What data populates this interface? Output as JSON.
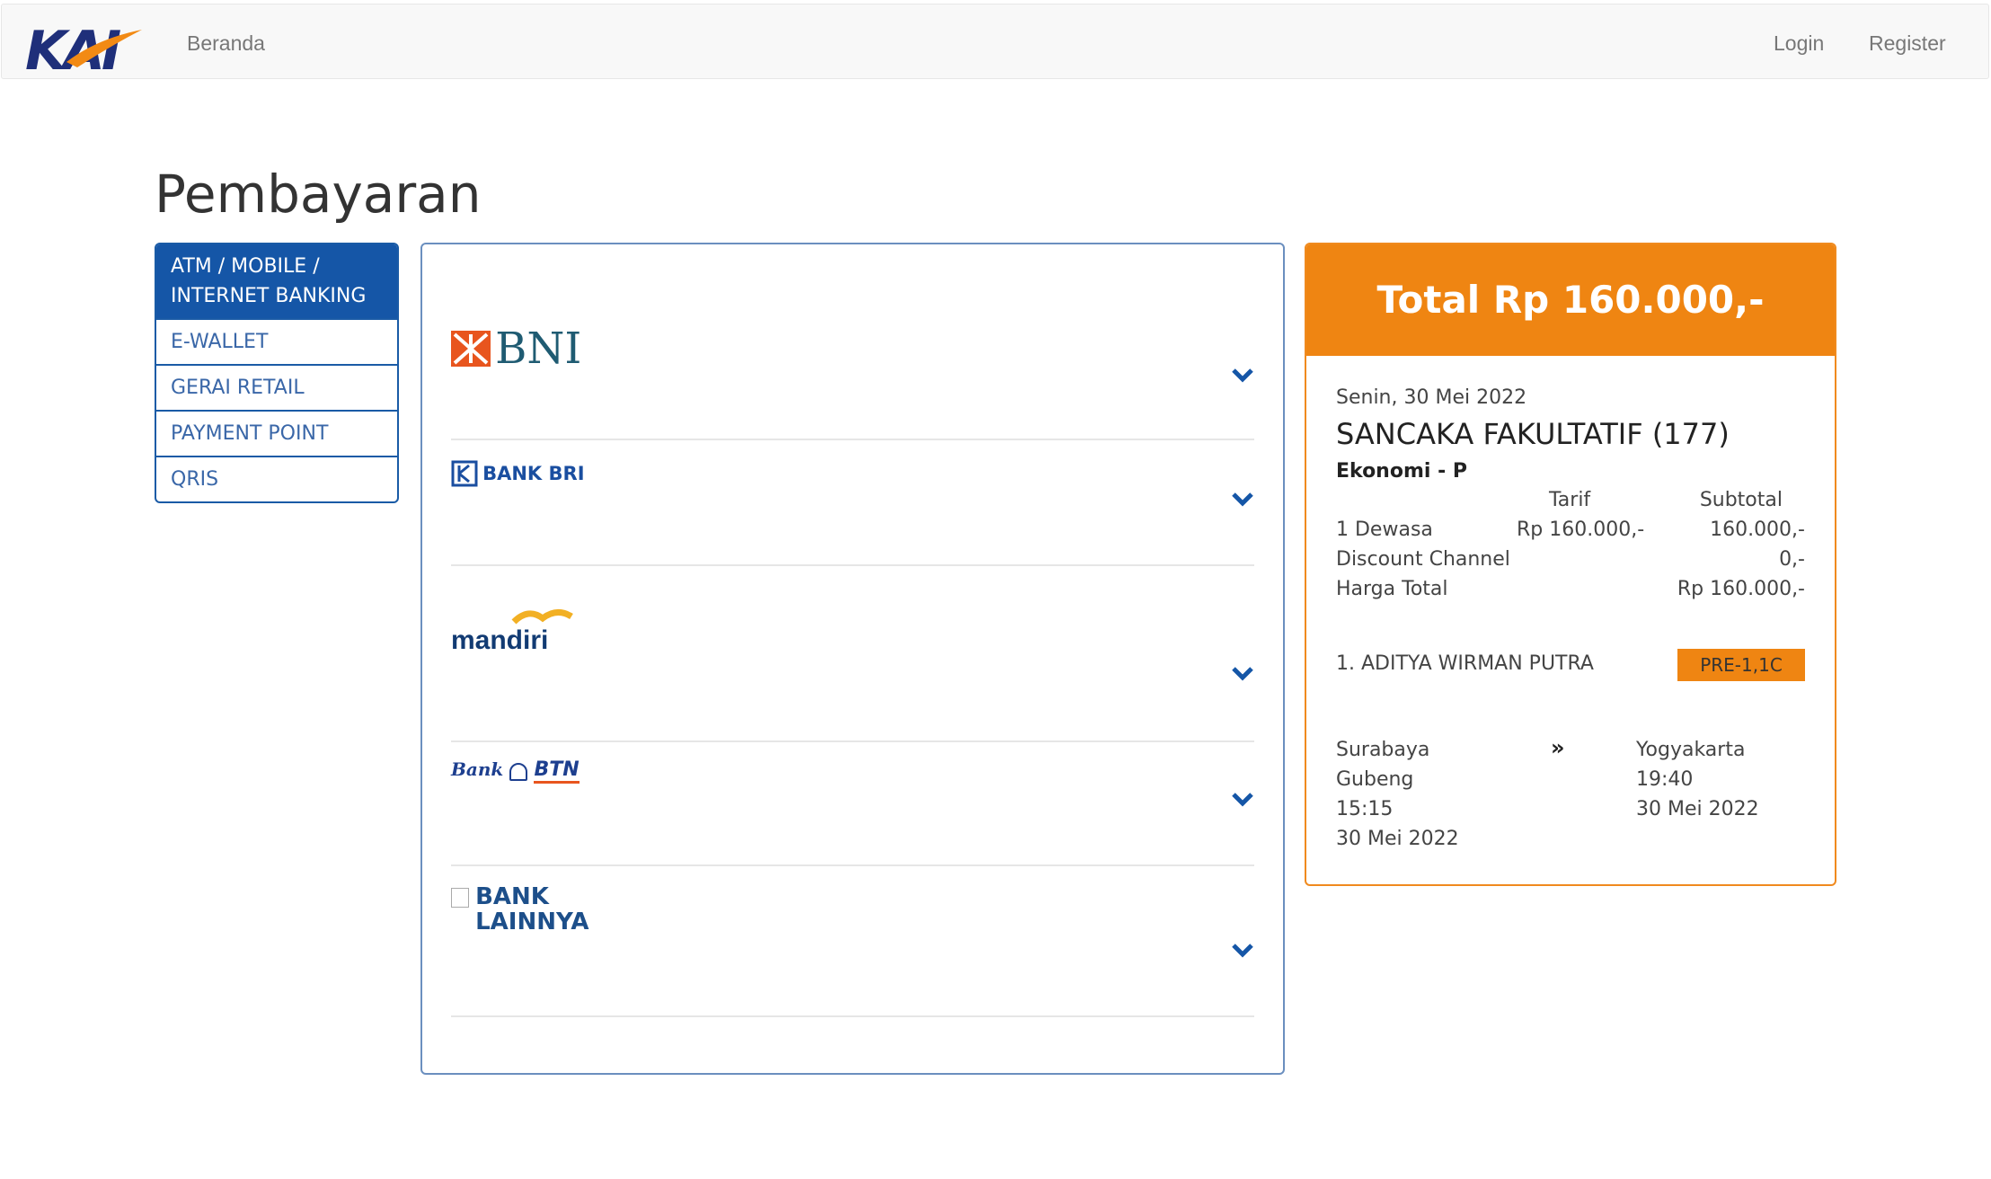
{
  "navbar": {
    "brand": "KAI",
    "home_label": "Beranda",
    "login_label": "Login",
    "register_label": "Register"
  },
  "page_title": "Pembayaran",
  "payment_tabs": [
    {
      "label": "ATM / MOBILE / INTERNET BANKING",
      "active": true
    },
    {
      "label": "E-WALLET",
      "active": false
    },
    {
      "label": "GERAI RETAIL",
      "active": false
    },
    {
      "label": "PAYMENT POINT",
      "active": false
    },
    {
      "label": "QRIS",
      "active": false
    }
  ],
  "banks": [
    {
      "name": "BNI",
      "icon": "bni-logo"
    },
    {
      "name": "BANK BRI",
      "icon": "bri-logo"
    },
    {
      "name": "mandiri",
      "icon": "mandiri-logo"
    },
    {
      "name_a": "Bank",
      "name_b": "BTN",
      "icon": "btn-logo"
    },
    {
      "name": "BANK LAINNYA",
      "icon": "broken-image-icon"
    }
  ],
  "summary": {
    "total": "Total Rp 160.000,-",
    "date": "Senin, 30 Mei 2022",
    "train": "SANCAKA FAKULTATIF (177)",
    "class": "Ekonomi - P",
    "col_tarif": "Tarif",
    "col_subtotal": "Subtotal",
    "rows": [
      {
        "label": "1 Dewasa",
        "tarif": "Rp 160.000,-",
        "subtotal": "160.000,-"
      },
      {
        "label": "Discount Channel",
        "subtotal": "0,-"
      },
      {
        "label": "Harga Total",
        "subtotal": "Rp 160.000,-"
      }
    ],
    "passenger": "1. ADITYA WIRMAN PUTRA",
    "seat": "PRE-1,1C",
    "origin": {
      "city": "Surabaya",
      "station": "Gubeng",
      "time": "15:15",
      "date": "30 Mei 2022"
    },
    "arrow": "»",
    "destination": {
      "city": "Yogyakarta",
      "time": "19:40",
      "date": "30 Mei 2022"
    }
  },
  "colors": {
    "primary_blue": "#1556a7",
    "accent_orange": "#ef8512",
    "navbar_bg": "#f8f8f8"
  }
}
